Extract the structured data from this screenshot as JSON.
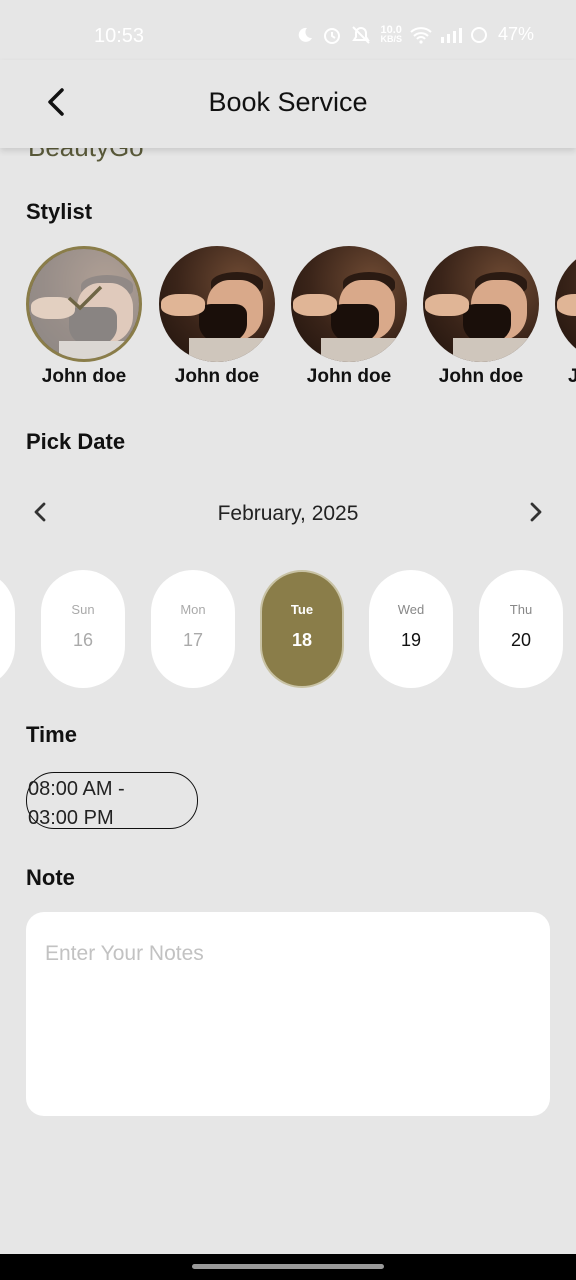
{
  "status_bar": {
    "time": "10:53",
    "net_speed_top": "10.0",
    "net_speed_bottom": "KB/S",
    "battery": "47%",
    "icons": [
      "moon-icon",
      "alarm-icon",
      "mute-icon",
      "wifi-icon",
      "signal-icon",
      "battery-icon"
    ]
  },
  "header": {
    "title": "Book Service",
    "back_icon": "chevron-left-icon"
  },
  "brand_peek": "BeautyGo",
  "stylist_section": {
    "title": "Stylist",
    "stylists": [
      {
        "name": "John doe",
        "selected": true
      },
      {
        "name": "John doe",
        "selected": false
      },
      {
        "name": "John doe",
        "selected": false
      },
      {
        "name": "John doe",
        "selected": false
      },
      {
        "name": "J",
        "selected": false
      }
    ]
  },
  "date_section": {
    "title": "Pick Date",
    "month_label": "February, 2025",
    "prev_icon": "chevron-left-icon",
    "next_icon": "chevron-right-icon",
    "days": [
      {
        "dow": "",
        "num": "",
        "state": "past"
      },
      {
        "dow": "Sun",
        "num": "16",
        "state": "past"
      },
      {
        "dow": "Mon",
        "num": "17",
        "state": "past"
      },
      {
        "dow": "Tue",
        "num": "18",
        "state": "active"
      },
      {
        "dow": "Wed",
        "num": "19",
        "state": "future"
      },
      {
        "dow": "Thu",
        "num": "20",
        "state": "future"
      }
    ]
  },
  "time_section": {
    "title": "Time",
    "slot_line1": "08:00 AM -",
    "slot_line2": "03:00 PM"
  },
  "note_section": {
    "title": "Note",
    "placeholder": "Enter Your Notes",
    "value": ""
  },
  "colors": {
    "accent": "#8a7d49",
    "background": "#e6e6e6",
    "card": "#ffffff"
  }
}
